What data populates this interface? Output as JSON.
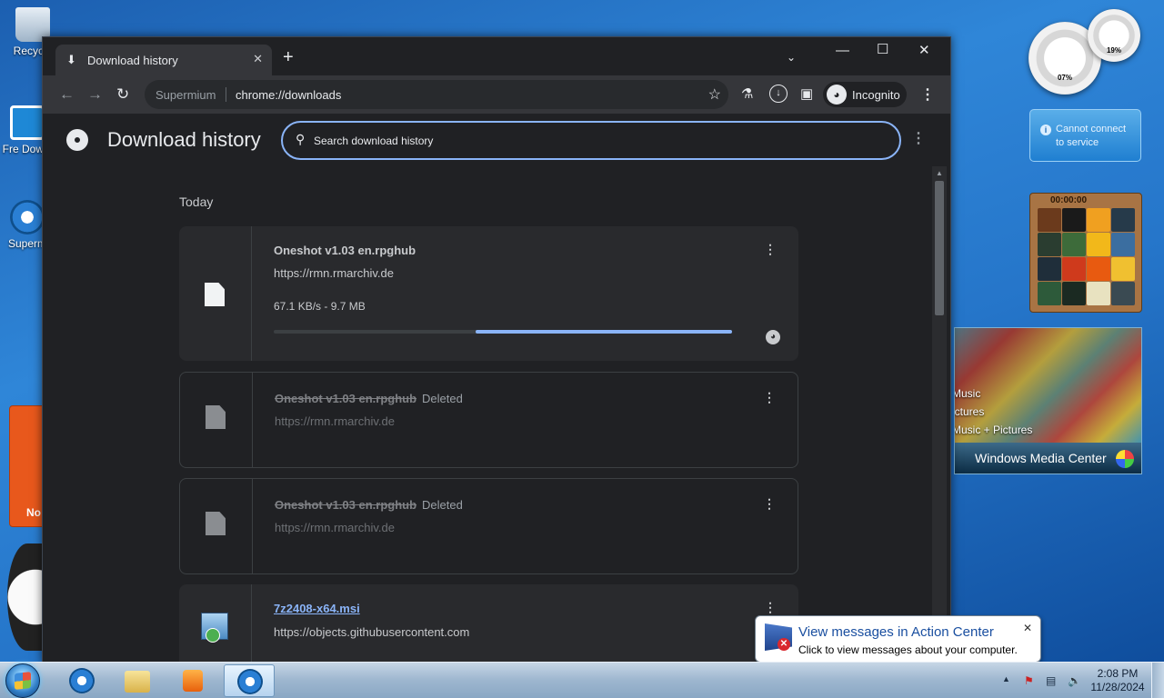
{
  "desktop": {
    "icons": [
      {
        "label": "Recycle"
      },
      {
        "label": "Fre Downl"
      },
      {
        "label": "Superm"
      }
    ],
    "calendar_text": "No"
  },
  "gadgets": {
    "cpu_meter": {
      "cpu": "07%",
      "memory": "19%"
    },
    "weather": {
      "message": "Cannot connect to service"
    },
    "puzzle": {
      "timer": "00:00:00"
    },
    "media_center": {
      "menu": [
        "Music",
        "ictures",
        "Music + Pictures"
      ],
      "title": "Windows Media Center"
    }
  },
  "browser": {
    "tab": {
      "title": "Download history",
      "icon": "download-icon"
    },
    "toolbar": {
      "origin": "Supermium",
      "url": "chrome://downloads",
      "profile_label": "Incognito"
    },
    "page": {
      "title": "Download history",
      "search_placeholder": "Search download history",
      "date_header": "Today",
      "downloads": [
        {
          "name": "Oneshot v1.03 en.rpghub",
          "url": "https://rmn.rmarchiv.de",
          "progress_text": "67.1 KB/s - 9.7 MB",
          "progress_fraction_start": 0.44,
          "progress_fraction_end": 1.0,
          "state": "in_progress"
        },
        {
          "name": "Oneshot v1.03 en.rpghub",
          "status": "Deleted",
          "url": "https://rmn.rmarchiv.de",
          "state": "deleted"
        },
        {
          "name": "Oneshot v1.03 en.rpghub",
          "status": "Deleted",
          "url": "https://rmn.rmarchiv.de",
          "state": "deleted"
        },
        {
          "name": "7z2408-x64.msi",
          "url": "https://objects.githubusercontent.com",
          "state": "complete"
        }
      ]
    }
  },
  "notification": {
    "title": "View messages in Action Center",
    "text": "Click to view messages about your computer."
  },
  "taskbar": {
    "time": "2:08 PM",
    "date": "11/28/2024"
  },
  "colors": {
    "accent": "#8ab4f8",
    "page_bg": "#202124",
    "card_bg": "#292a2d"
  }
}
